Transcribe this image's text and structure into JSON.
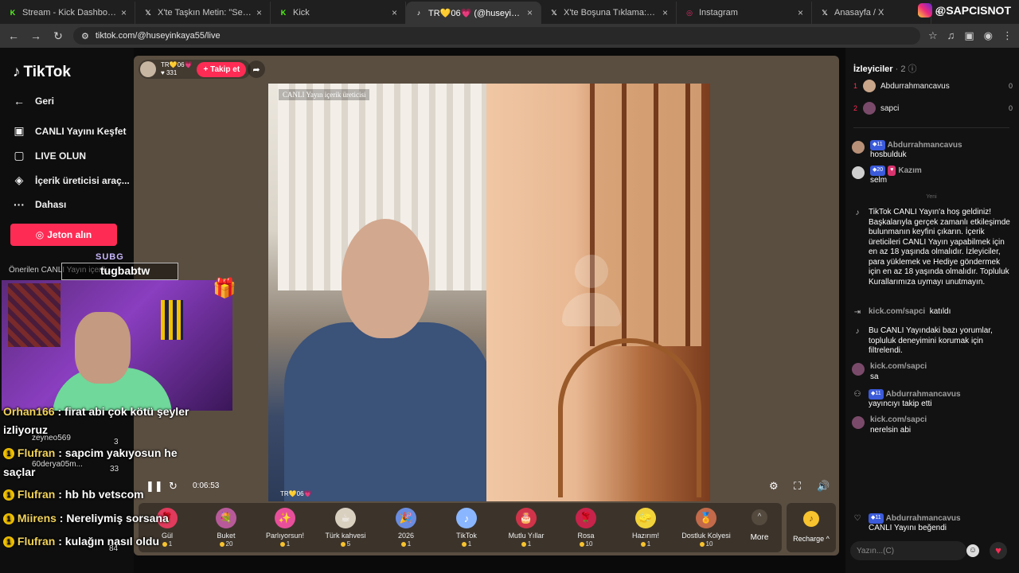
{
  "tabs": [
    {
      "label": "Stream - Kick Dashboard",
      "icon": "kick-icon",
      "color": "#53fc18"
    },
    {
      "label": "X'te Taşkın Metin: \"Sevgili Galat",
      "icon": "x-icon",
      "color": "#ffffff"
    },
    {
      "label": "Kick",
      "icon": "kick-icon",
      "color": "#53fc18"
    },
    {
      "label": "TR💛06💗 (@huseyinkaya5",
      "icon": "tiktok-icon",
      "color": "#ffffff",
      "active": true
    },
    {
      "label": "X'te Boşuna Tıklama: \"Orkun Iş",
      "icon": "x-icon",
      "color": "#ffffff"
    },
    {
      "label": "Instagram",
      "icon": "instagram-icon",
      "color": "#e1306c"
    },
    {
      "label": "Anasayfa / X",
      "icon": "x-icon",
      "color": "#ffffff"
    }
  ],
  "overlay_brand": "@SAPCISNOT",
  "address": {
    "url": "tiktok.com/@huseyinkaya55/live"
  },
  "sidebar": {
    "logo": "TikTok",
    "back": "Geri",
    "items": [
      {
        "label": "CANLI Yayını Keşfet",
        "icon": "live-tv-icon"
      },
      {
        "label": "LIVE OLUN",
        "icon": "camera-icon"
      },
      {
        "label": "İçerik üreticisi araç...",
        "icon": "lightbulb-icon"
      },
      {
        "label": "Dahası",
        "icon": "more-dots-icon"
      }
    ],
    "jeton_button": "Jeton alın",
    "suggested": "Önerilen CANLI Yayın içerik..."
  },
  "host": {
    "name": "TR💛06💗",
    "followers": "331",
    "follow_button": "+ Takip et"
  },
  "video": {
    "label": "CANLI Yayın içerik üreticisi",
    "timer": "0:06:53",
    "tag": "TR💛06💗"
  },
  "gifts": [
    {
      "name": "Gül",
      "price": "1",
      "color": "#e03a5c",
      "glyph": "🌹"
    },
    {
      "name": "Buket",
      "price": "20",
      "color": "#b85a9a",
      "glyph": "💐"
    },
    {
      "name": "Parlıyorsun!",
      "price": "1",
      "color": "#e84f9b",
      "glyph": "✨"
    },
    {
      "name": "Türk kahvesi",
      "price": "5",
      "color": "#d9d0c0",
      "glyph": "☕"
    },
    {
      "name": "2026",
      "price": "1",
      "color": "#6a8ce0",
      "glyph": "🎉"
    },
    {
      "name": "TikTok",
      "price": "1",
      "color": "#8ab6ff",
      "glyph": "♪"
    },
    {
      "name": "Mutlu Yıllar",
      "price": "1",
      "color": "#d0344a",
      "glyph": "🎂"
    },
    {
      "name": "Rosa",
      "price": "10",
      "color": "#c8234a",
      "glyph": "🌹"
    },
    {
      "name": "Hazırım!",
      "price": "1",
      "color": "#f2d23a",
      "glyph": "🧽"
    },
    {
      "name": "Dostluk Kolyesi",
      "price": "10",
      "color": "#c26a4a",
      "glyph": "🏅"
    }
  ],
  "more_label": "More",
  "recharge_label": "Recharge ^",
  "viewers": {
    "title": "İzleyiciler",
    "count": "· 2",
    "list": [
      {
        "rank": "1",
        "name": "Abdurrahmancavus",
        "score": "0"
      },
      {
        "rank": "2",
        "name": "sapci",
        "score": "0"
      }
    ]
  },
  "chat": {
    "yeni": "Yeni",
    "placeholder": "Yazın...(C)",
    "messages": [
      {
        "name": "Abdurrahmancavus",
        "level": "11",
        "text": "hosbulduk"
      },
      {
        "name": "Kazım",
        "level": "20",
        "text": "selm"
      },
      {
        "system": true,
        "text": "TikTok CANLI Yayın'a hoş geldiniz! Başkalarıyla gerçek zamanlı etkileşimde bulunmanın keyfini çıkarın. İçerik üreticileri CANLI Yayın yapabilmek için en az 18 yaşında olmalıdır. İzleyiciler, para yüklemek ve Hediye göndermek için en az 18 yaşında olmalıdır. Topluluk Kurallarımıza uymayı unutmayın."
      },
      {
        "name": "kick.com/sapci",
        "text": "katıldı",
        "inline": true
      },
      {
        "system": true,
        "text": "Bu CANLI Yayındaki bazı yorumlar, topluluk deneyimini korumak için filtrelendi."
      },
      {
        "name": "kick.com/sapci",
        "text": "sa"
      },
      {
        "name": "Abdurrahmancavus",
        "level": "11",
        "text": "yayıncıyı takip etti"
      },
      {
        "name": "kick.com/sapci",
        "text": "nerelsin abi"
      },
      {
        "name": "Abdurrahmancavus",
        "level": "11",
        "text": "CANLI Yayını beğendi"
      }
    ]
  },
  "overlay": {
    "subg": "SUBG",
    "tugb": "tugbabtw",
    "chat": [
      {
        "name": "Orhan166",
        "text": " : firat abi çok kötü şeyler"
      },
      {
        "name": "",
        "text": "izliyoruz"
      },
      {
        "name": "Flufran",
        "text": " : sapcim yakıyosun he"
      },
      {
        "name": "",
        "text": "saçlar"
      },
      {
        "name": "Flufran",
        "text": " : hb hb vetscom"
      },
      {
        "name": "Miirens",
        "text": " : Nereliymiş sorsana"
      },
      {
        "name": "Flufran",
        "text": " : kulağın nasıl oldu"
      }
    ],
    "small": [
      "zeyneo569",
      "3",
      "60derya05m...",
      "33",
      "84"
    ]
  }
}
